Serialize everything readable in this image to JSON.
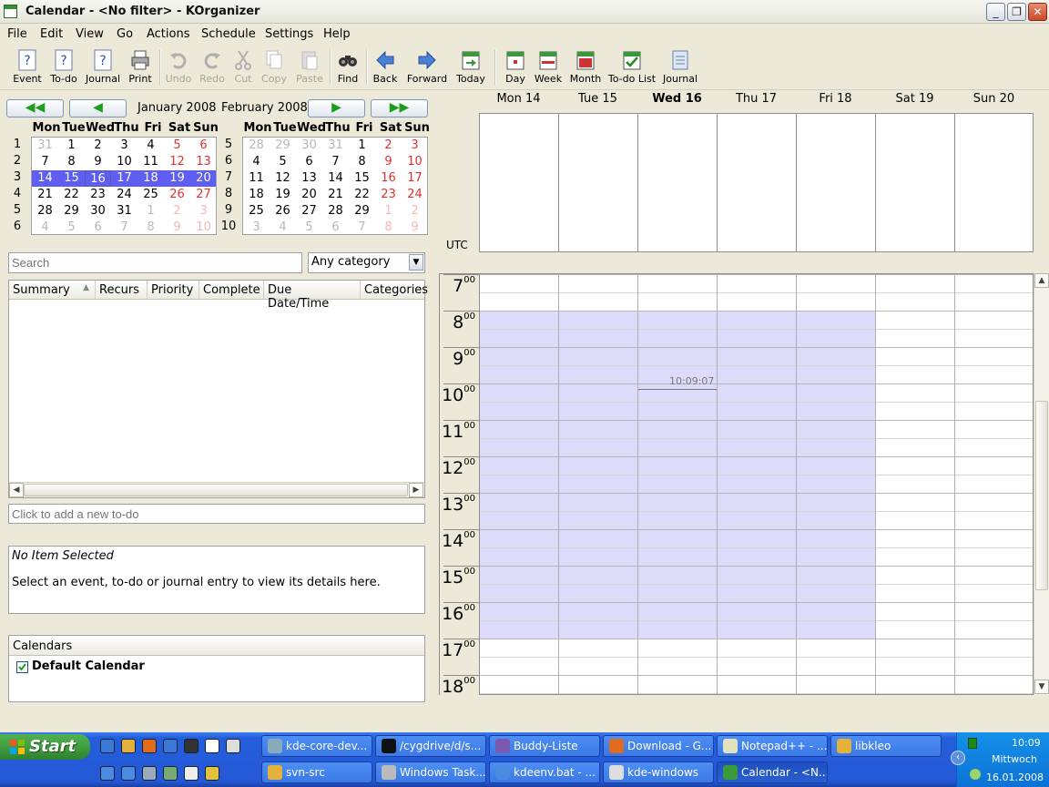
{
  "window": {
    "title": "Calendar - <No filter> - KOrganizer",
    "min": "_",
    "max": "❐",
    "close": "✕"
  },
  "menu": [
    "File",
    "Edit",
    "View",
    "Go",
    "Actions",
    "Schedule",
    "Settings",
    "Help"
  ],
  "toolbar": {
    "event": "Event",
    "todo": "To-do",
    "journal": "Journal",
    "print": "Print",
    "undo": "Undo",
    "redo": "Redo",
    "cut": "Cut",
    "copy": "Copy",
    "paste": "Paste",
    "find": "Find",
    "back": "Back",
    "forward": "Forward",
    "today": "Today",
    "day": "Day",
    "week": "Week",
    "month": "Month",
    "todolist": "To-do List",
    "journalview": "Journal"
  },
  "navigator": {
    "month1": "January 2008",
    "month2": "February 2008",
    "dow": [
      "Mon",
      "Tue",
      "Wed",
      "Thu",
      "Fri",
      "Sat",
      "Sun"
    ],
    "weeks1": [
      "1",
      "2",
      "3",
      "4",
      "5",
      "6"
    ],
    "weeks2": [
      "5",
      "6",
      "7",
      "8",
      "9",
      "10"
    ],
    "jan": [
      [
        "31",
        "1",
        "2",
        "3",
        "4",
        "5",
        "6"
      ],
      [
        "7",
        "8",
        "9",
        "10",
        "11",
        "12",
        "13"
      ],
      [
        "14",
        "15",
        "16",
        "17",
        "18",
        "19",
        "20"
      ],
      [
        "21",
        "22",
        "23",
        "24",
        "25",
        "26",
        "27"
      ],
      [
        "28",
        "29",
        "30",
        "31",
        "1",
        "2",
        "3"
      ],
      [
        "4",
        "5",
        "6",
        "7",
        "8",
        "9",
        "10"
      ]
    ],
    "feb": [
      [
        "28",
        "29",
        "30",
        "31",
        "1",
        "2",
        "3"
      ],
      [
        "4",
        "5",
        "6",
        "7",
        "8",
        "9",
        "10"
      ],
      [
        "11",
        "12",
        "13",
        "14",
        "15",
        "16",
        "17"
      ],
      [
        "18",
        "19",
        "20",
        "21",
        "22",
        "23",
        "24"
      ],
      [
        "25",
        "26",
        "27",
        "28",
        "29",
        "1",
        "2"
      ],
      [
        "3",
        "4",
        "5",
        "6",
        "7",
        "8",
        "9"
      ]
    ]
  },
  "search": {
    "placeholder": "Search",
    "category": "Any category"
  },
  "todolist": {
    "columns": [
      "Summary",
      "Recurs",
      "Priority",
      "Complete",
      "Due Date/Time",
      "Categories"
    ],
    "sort_arrow": "▲",
    "add_placeholder": "Click to add a new to-do"
  },
  "detail": {
    "title": "No Item Selected",
    "text": "Select an event, to-do or journal entry to view its details here."
  },
  "calendars": {
    "header": "Calendars",
    "items": [
      {
        "name": "Default Calendar",
        "checked": true
      }
    ]
  },
  "week": {
    "days": [
      "Mon 14",
      "Tue 15",
      "Wed 16",
      "Thu 17",
      "Fri 18",
      "Sat 19",
      "Sun 20"
    ],
    "today_index": 2,
    "tz": "UTC",
    "hours": [
      "7",
      "8",
      "9",
      "10",
      "11",
      "12",
      "13",
      "14",
      "15",
      "16",
      "17",
      "18"
    ],
    "minutes_sup": "00",
    "now_label": "10:09:07",
    "work_start_hour": 8,
    "work_end_hour": 17
  },
  "taskbar": {
    "start": "Start",
    "row1": [
      "kde-core-dev...",
      "/cygdrive/d/s...",
      "Buddy-Liste",
      "Download - G...",
      "Notepad++ - ...",
      "libkleo"
    ],
    "row2": [
      "svn-src",
      "Windows Task...",
      "kdeenv.bat - ...",
      "kde-windows",
      "Calendar - <N..."
    ],
    "clock": "10:09",
    "weekday": "Mittwoch",
    "date": "16.01.2008"
  },
  "colors": {
    "selection": "#5e5ef2",
    "working_hours": "#dcdcfa",
    "weekend": "#e03030"
  }
}
